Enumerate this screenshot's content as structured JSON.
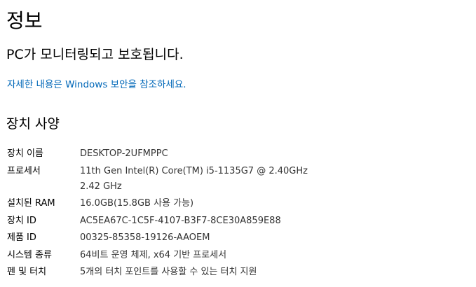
{
  "header": {
    "title": "정보"
  },
  "protection": {
    "status": "PC가 모니터링되고 보호됩니다.",
    "details_link": "자세한 내용은 Windows 보안을 참조하세요."
  },
  "device_specs": {
    "title": "장치 사양",
    "rows": [
      {
        "label": "장치 이름",
        "values": [
          "DESKTOP-2UFMPPC"
        ]
      },
      {
        "label": "프로세서",
        "values": [
          "11th Gen Intel(R) Core(TM) i5-1135G7 @ 2.40GHz",
          "2.42 GHz"
        ]
      },
      {
        "label": "설치된 RAM",
        "values": [
          "16.0GB(15.8GB 사용 가능)"
        ]
      },
      {
        "label": "장치 ID",
        "values": [
          "AC5EA67C-1C5F-4107-B3F7-8CE30A859E88"
        ]
      },
      {
        "label": "제품 ID",
        "values": [
          "00325-85358-19126-AAOEM"
        ]
      },
      {
        "label": "시스템 종류",
        "values": [
          "64비트 운영 체제, x64 기반 프로세서"
        ]
      },
      {
        "label": "펜 및 터치",
        "values": [
          "5개의 터치 포인트를 사용할 수 있는 터치 지원"
        ]
      }
    ]
  },
  "colors": {
    "link": "#0067b8",
    "value_text": "#333333"
  }
}
